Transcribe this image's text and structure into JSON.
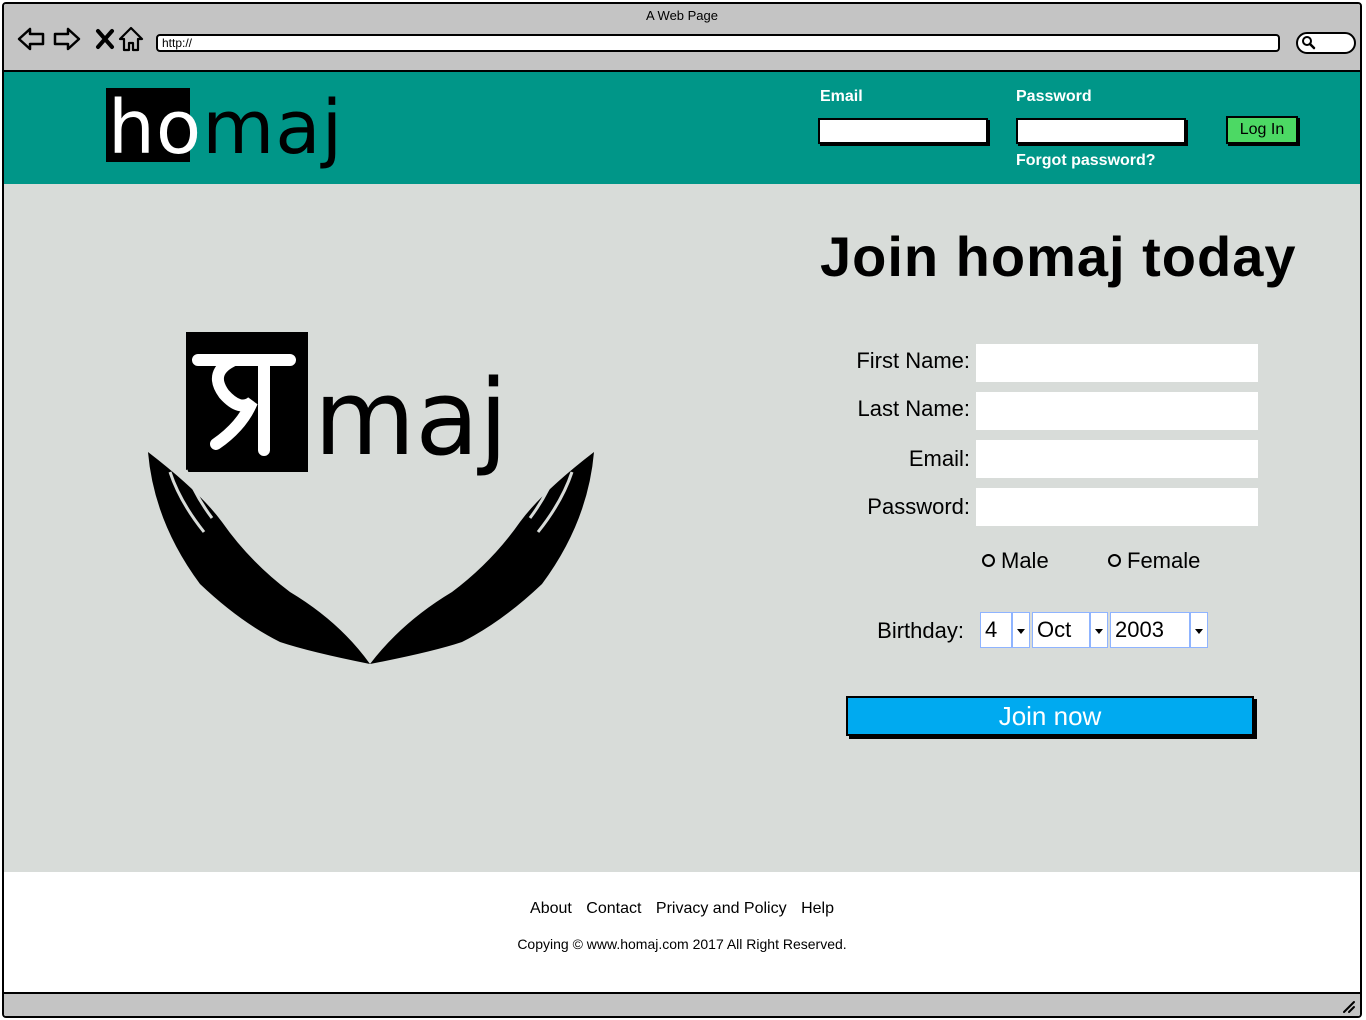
{
  "window": {
    "title": "A Web Page"
  },
  "browser": {
    "url": "http://"
  },
  "header": {
    "logo_white": "ho",
    "logo_black": "maj",
    "email_label": "Email",
    "password_label": "Password",
    "forgot_label": "Forgot password?",
    "login_label": "Log In"
  },
  "hero": {
    "logo_text": "maj"
  },
  "signup": {
    "title": "Join homaj today",
    "first_name_label": "First Name:",
    "last_name_label": "Last Name:",
    "email_label": "Email:",
    "password_label": "Password:",
    "gender_male": "Male",
    "gender_female": "Female",
    "birthday_label": "Birthday:",
    "birthday_day": "4",
    "birthday_month": "Oct",
    "birthday_year": "2003",
    "join_label": "Join now"
  },
  "footer": {
    "links": [
      "About",
      "Contact",
      "Privacy and Policy",
      "Help"
    ],
    "copyright": "Copying © www.homaj.com 2017 All Right Reserved."
  },
  "colors": {
    "header": "#009688",
    "main_bg": "#d8dcd9",
    "login_button": "#4cd964",
    "join_button": "#00aaf0"
  }
}
